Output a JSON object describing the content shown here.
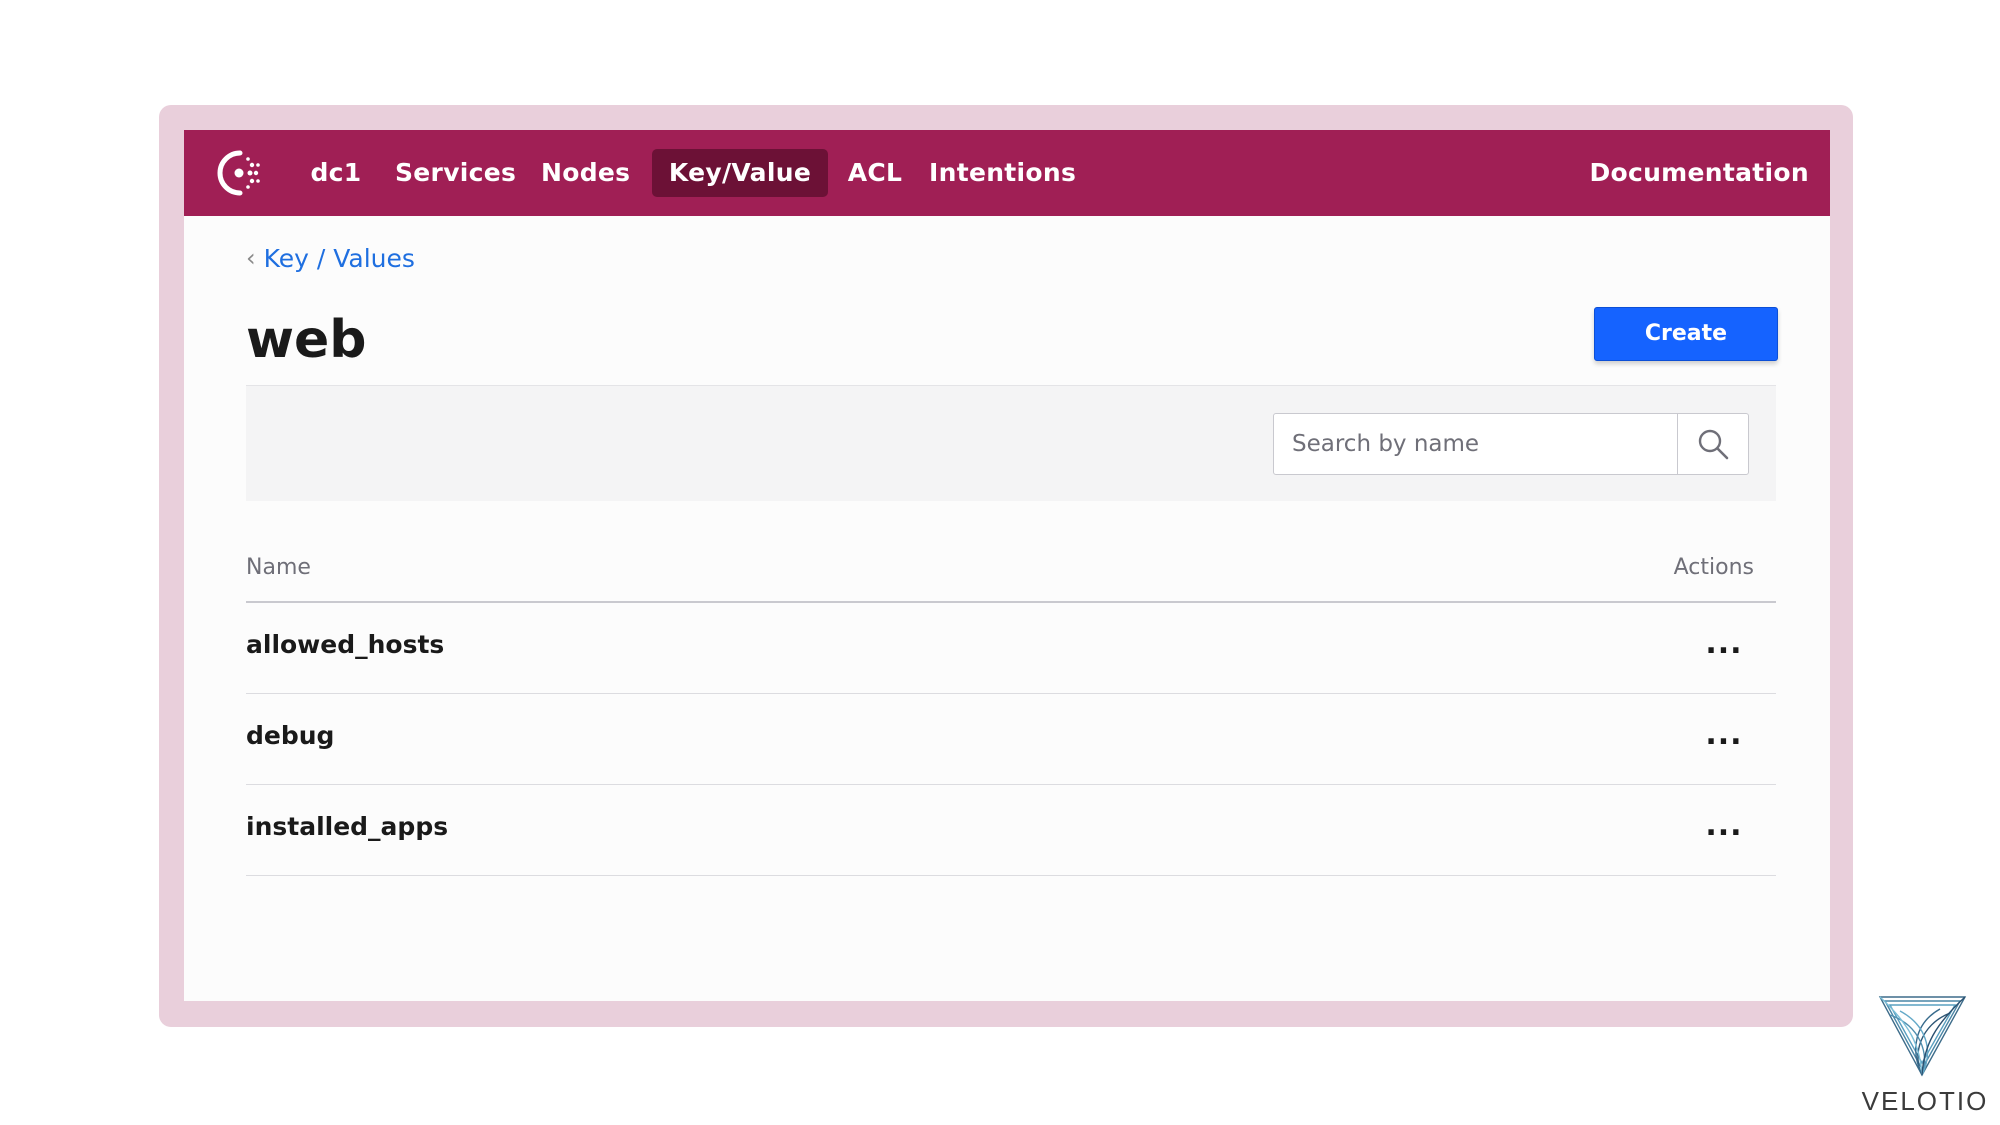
{
  "nav": {
    "datacenter": "dc1",
    "items": [
      {
        "label": "Services"
      },
      {
        "label": "Nodes"
      },
      {
        "label": "Key/Value"
      },
      {
        "label": "ACL"
      },
      {
        "label": "Intentions"
      }
    ],
    "documentation": "Documentation",
    "active_item": "Key/Value",
    "brand_color": "#a01f55",
    "active_color": "#6c1136"
  },
  "breadcrumb": {
    "label": "Key / Values"
  },
  "page": {
    "title": "web",
    "create_label": "Create"
  },
  "search": {
    "placeholder": "Search by name",
    "value": ""
  },
  "table": {
    "columns": [
      "Name",
      "Actions"
    ],
    "rows": [
      {
        "name": "allowed_hosts",
        "actions": "..."
      },
      {
        "name": "debug",
        "actions": "..."
      },
      {
        "name": "installed_apps",
        "actions": "..."
      }
    ]
  },
  "watermark": {
    "text": "VELOTIO"
  },
  "colors": {
    "primary_button": "#1563ff",
    "link": "#1f6fe0",
    "frame": "#e9cfdb"
  }
}
